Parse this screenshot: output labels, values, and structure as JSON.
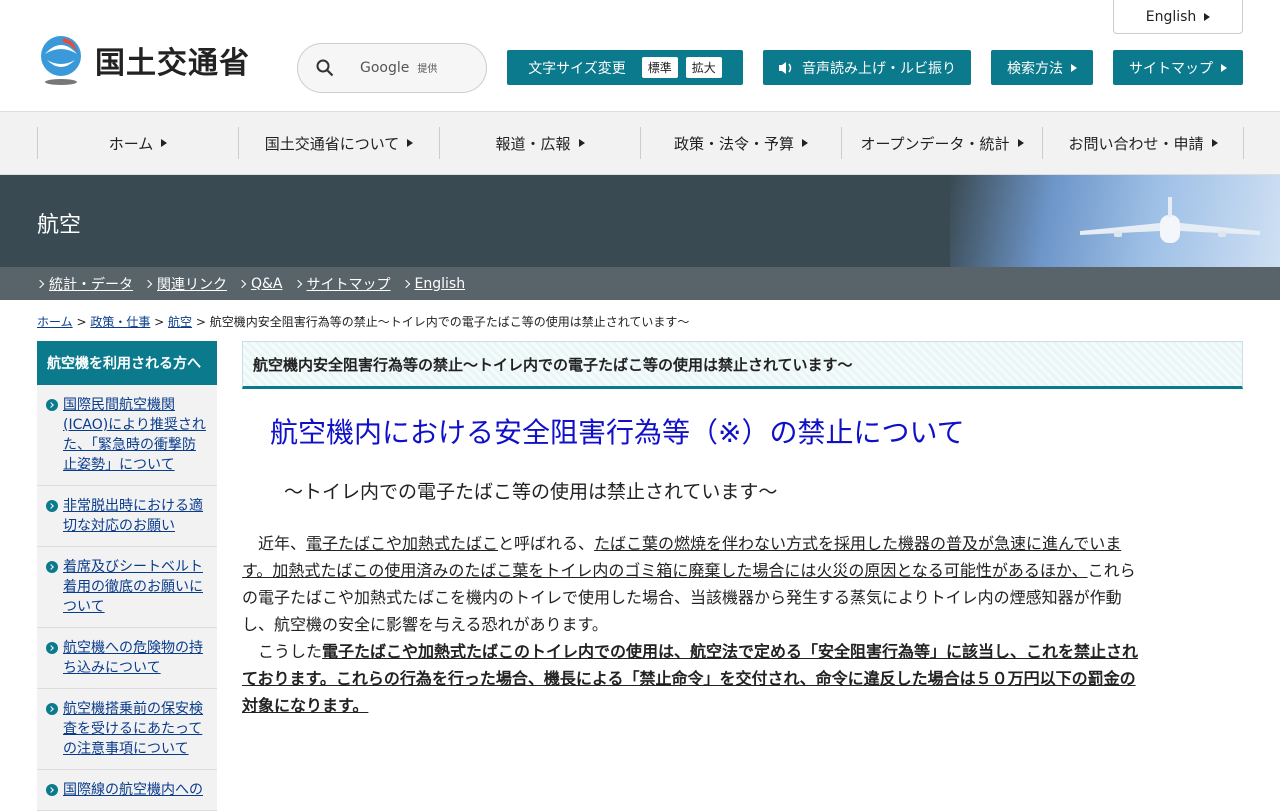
{
  "header": {
    "logo_text": "国土交通省",
    "search_brand": "Google",
    "search_suffix": "提供",
    "english_label": "English",
    "font_size_label": "文字サイズ変更",
    "font_standard": "標準",
    "font_large": "拡大",
    "voice_label": "音声読み上げ・ルビ振り",
    "search_method_label": "検索方法",
    "sitemap_label": "サイトマップ"
  },
  "gnav": [
    {
      "label": "ホーム"
    },
    {
      "label": "国土交通省について"
    },
    {
      "label": "報道・広報"
    },
    {
      "label": "政策・法令・予算"
    },
    {
      "label": "オープンデータ・統計"
    },
    {
      "label": "お問い合わせ・申請"
    }
  ],
  "hero": {
    "title": "航空"
  },
  "subnav": [
    {
      "label": "統計・データ"
    },
    {
      "label": "関連リンク"
    },
    {
      "label": "Q&A"
    },
    {
      "label": "サイトマップ"
    },
    {
      "label": "English"
    }
  ],
  "breadcrumb": {
    "home": "ホーム",
    "policy": "政策・仕事",
    "aviation": "航空",
    "current": "航空機内安全阻害行為等の禁止～トイレ内での電子たばこ等の使用は禁止されています～",
    "sep": " > "
  },
  "sidebar": {
    "heading": "航空機を利用される方へ",
    "items": [
      {
        "label": "国際民間航空機関(ICAO)により推奨された、「緊急時の衝撃防止姿勢」について"
      },
      {
        "label": "非常脱出時における適切な対応のお願い"
      },
      {
        "label": "着席及びシートベルト着用の徹底のお願いについて"
      },
      {
        "label": "航空機への危険物の持ち込みについて"
      },
      {
        "label": "航空機搭乗前の保安検査を受けるにあたっての注意事項について"
      },
      {
        "label": "国際線の航空機内への"
      }
    ]
  },
  "main": {
    "title_bar": "航空機内安全阻害行為等の禁止～トイレ内での電子たばこ等の使用は禁止されています～",
    "h1": "航空機内における安全阻害行為等（※）の禁止について",
    "h2": "～トイレ内での電子たばこ等の使用は禁止されています～",
    "p1_a": "　近年、",
    "p1_b": "電子たばこや加熱式たばこ",
    "p1_c": "と呼ばれる、",
    "p1_d": "たばこ葉の燃焼を伴わない方式を採用した機器の普及が急速に進んでいます。加熱式たばこの使用済みのたばこ葉をトイレ内のゴミ箱に廃棄した場合には火災の原因となる可能性があるほか、",
    "p1_e": "これらの電子たばこや加熱式たばこを機内のトイレで使用した場合、当該機器から発生する蒸気によりトイレ内の煙感知器が作動し、航空機の安全に影響を与える恐れがあります。",
    "p2_a": "　こうした",
    "p2_b": "電子たばこや加熱式たばこのトイレ内での使用は、航空法で定める「安全阻害行為等」に該当し、これを禁止されております。これらの行為を行った場合、機長による「禁止命令」を交付され、命令に違反した場合は５０万円以下の罰金の対象になります。"
  },
  "colors": {
    "teal": "#0b7a8c",
    "hero_bg": "#3a4a52",
    "subnav_bg": "#59646a",
    "title_blue": "#1010c8",
    "link": "#0a3c8c"
  }
}
